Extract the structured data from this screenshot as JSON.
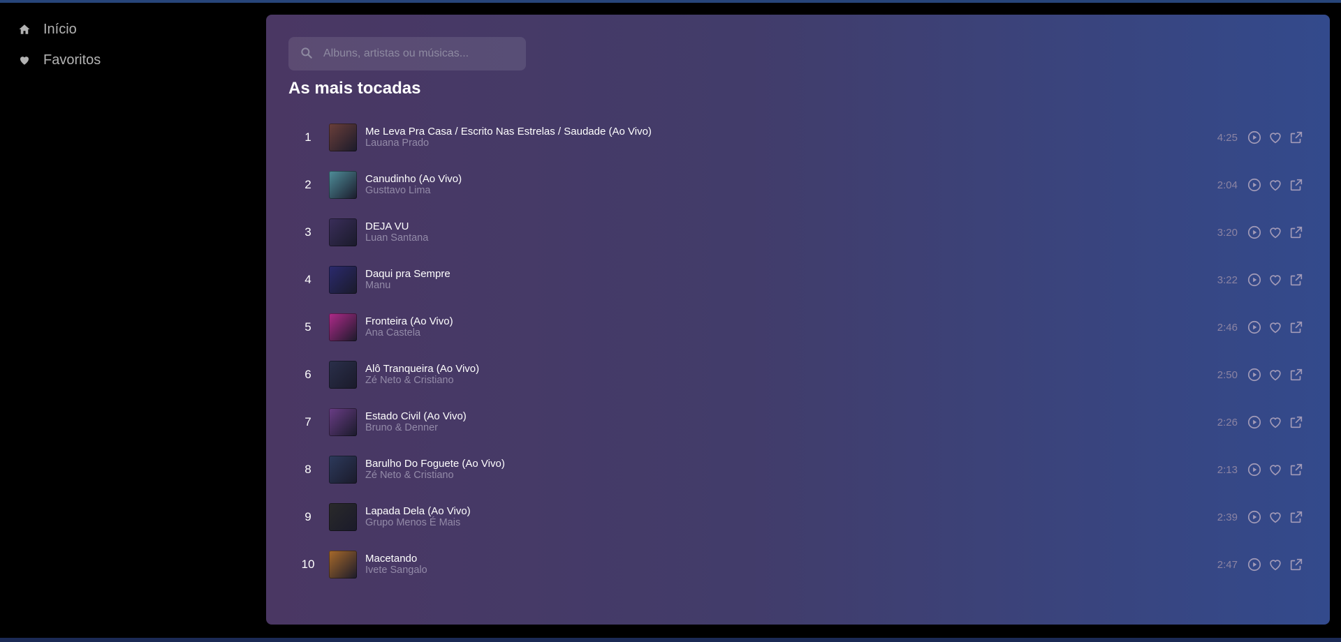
{
  "sidebar": {
    "items": [
      {
        "label": "Início",
        "icon": "home-icon"
      },
      {
        "label": "Favoritos",
        "icon": "heart-icon"
      }
    ]
  },
  "search": {
    "placeholder": "Albuns, artistas ou músicas..."
  },
  "main": {
    "heading": "As mais tocadas",
    "tracks": [
      {
        "rank": "1",
        "title": "Me Leva Pra Casa / Escrito Nas Estrelas / Saudade (Ao Vivo)",
        "artist": "Lauana Prado",
        "duration": "4:25",
        "cover_color": "#6b3f3a"
      },
      {
        "rank": "2",
        "title": "Canudinho (Ao Vivo)",
        "artist": "Gusttavo Lima",
        "duration": "2:04",
        "cover_color": "#4f8e9a"
      },
      {
        "rank": "3",
        "title": "DEJA VU",
        "artist": "Luan Santana",
        "duration": "3:20",
        "cover_color": "#3a2e5a"
      },
      {
        "rank": "4",
        "title": "Daqui pra Sempre",
        "artist": "Manu",
        "duration": "3:22",
        "cover_color": "#2b2a6e"
      },
      {
        "rank": "5",
        "title": "Fronteira (Ao Vivo)",
        "artist": "Ana Castela",
        "duration": "2:46",
        "cover_color": "#b02a8a"
      },
      {
        "rank": "6",
        "title": "Alô Tranqueira (Ao Vivo)",
        "artist": "Zé Neto & Cristiano",
        "duration": "2:50",
        "cover_color": "#2a2f4a"
      },
      {
        "rank": "7",
        "title": "Estado Civil (Ao Vivo)",
        "artist": "Bruno & Denner",
        "duration": "2:26",
        "cover_color": "#6a3d86"
      },
      {
        "rank": "8",
        "title": "Barulho Do Foguete (Ao Vivo)",
        "artist": "Zé Neto & Cristiano",
        "duration": "2:13",
        "cover_color": "#2d3a5c"
      },
      {
        "rank": "9",
        "title": "Lapada Dela (Ao Vivo)",
        "artist": "Grupo Menos É Mais",
        "duration": "2:39",
        "cover_color": "#2a2a2a"
      },
      {
        "rank": "10",
        "title": "Macetando",
        "artist": "Ivete Sangalo",
        "duration": "2:47",
        "cover_color": "#a86a2a"
      }
    ]
  },
  "icons": {
    "play": "play-circle-icon",
    "favorite": "heart-outline-icon",
    "open": "external-link-icon",
    "search": "search-icon"
  }
}
